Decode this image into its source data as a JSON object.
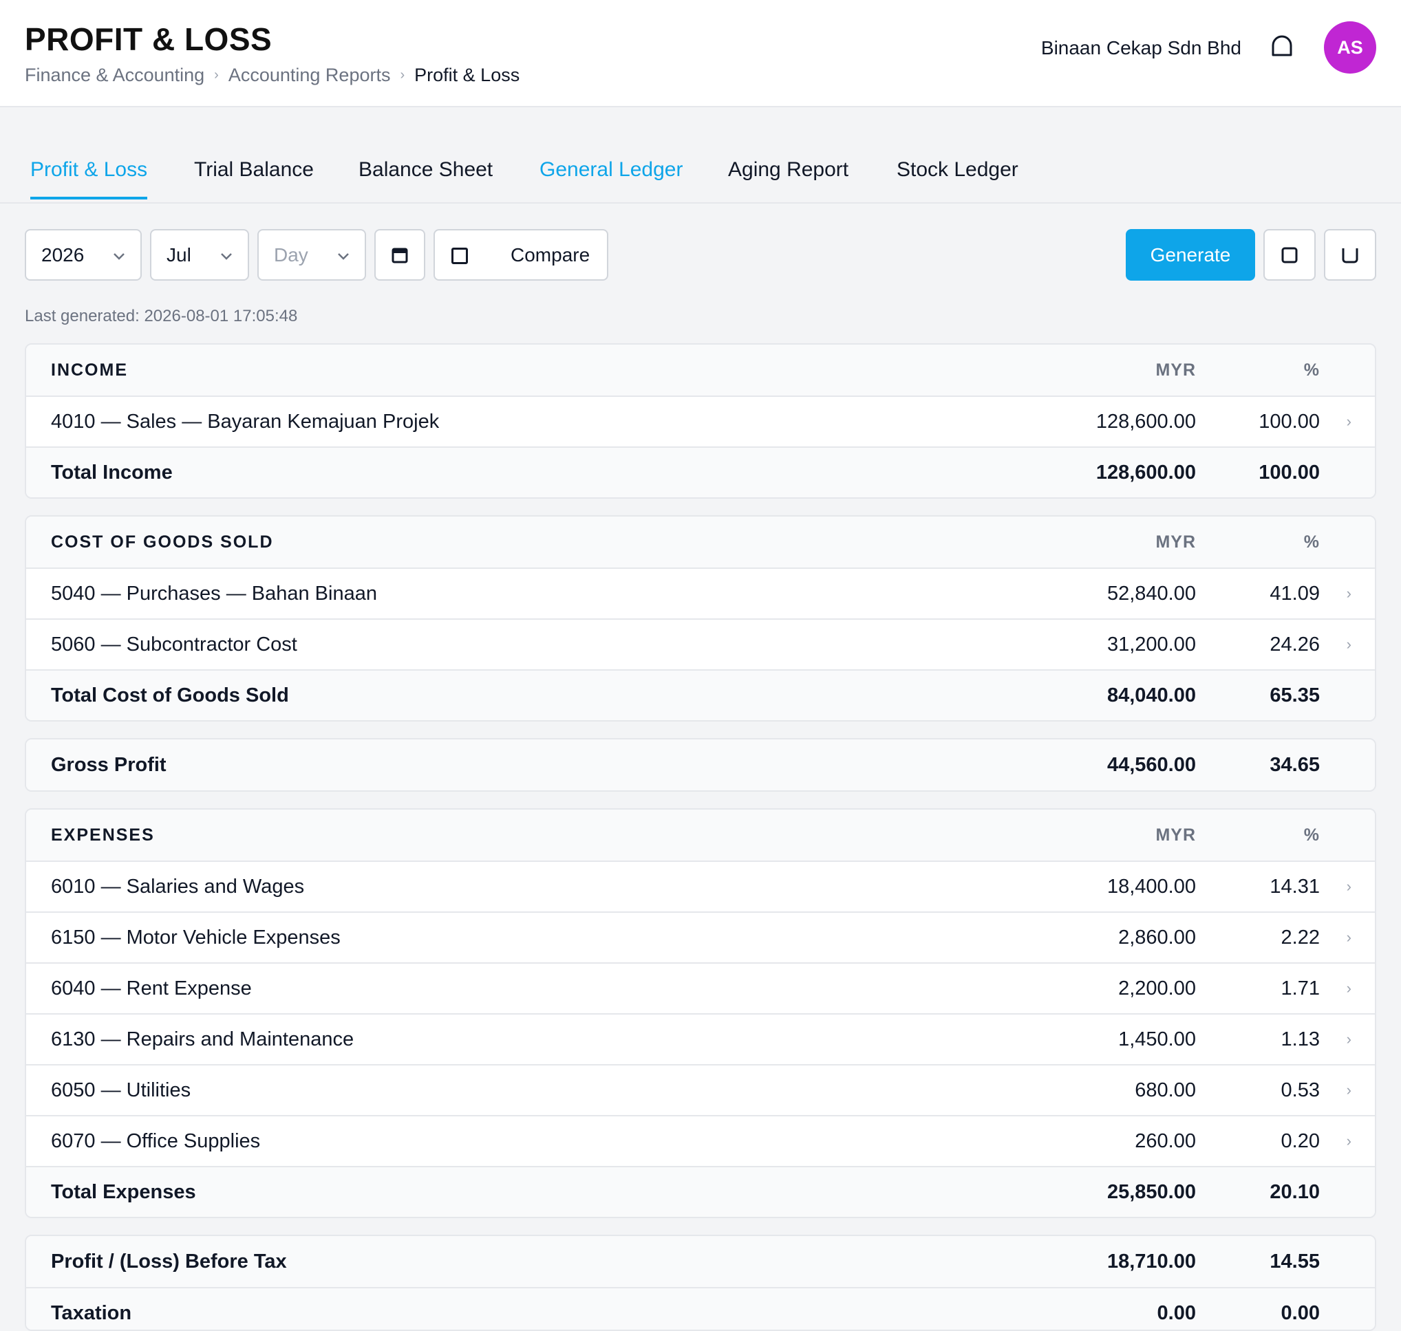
{
  "header": {
    "title": "PROFIT & LOSS",
    "breadcrumb": [
      "Finance & Accounting",
      "Accounting Reports",
      "Profit & Loss"
    ],
    "company": "Binaan Cekap Sdn Bhd",
    "avatar_initials": "AS",
    "avatar_color": "#c026d3"
  },
  "tabs": [
    {
      "label": "Profit & Loss",
      "state": "active"
    },
    {
      "label": "Trial Balance",
      "state": "normal"
    },
    {
      "label": "Balance Sheet",
      "state": "normal"
    },
    {
      "label": "General Ledger",
      "state": "link"
    },
    {
      "label": "Aging Report",
      "state": "normal"
    },
    {
      "label": "Stock Ledger",
      "state": "normal"
    }
  ],
  "filters": {
    "year": "2026",
    "month": "Jul",
    "day_placeholder": "Day",
    "compare_label": "Compare",
    "generate_label": "Generate",
    "accent_color": "#0ea5e9"
  },
  "last_generated": "Last generated: 2026-08-01 17:05:48",
  "columns": {
    "amount": "MYR",
    "percent": "%"
  },
  "income": {
    "heading": "INCOME",
    "rows": [
      {
        "label": "4010 — Sales — Bayaran Kemajuan Projek",
        "amount": "128,600.00",
        "percent": "100.00"
      }
    ],
    "total": {
      "label": "Total Income",
      "amount": "128,600.00",
      "percent": "100.00"
    }
  },
  "cogs": {
    "heading": "COST OF GOODS SOLD",
    "rows": [
      {
        "label": "5040 — Purchases — Bahan Binaan",
        "amount": "52,840.00",
        "percent": "41.09"
      },
      {
        "label": "5060 — Subcontractor Cost",
        "amount": "31,200.00",
        "percent": "24.26"
      }
    ],
    "total": {
      "label": "Total Cost of Goods Sold",
      "amount": "84,040.00",
      "percent": "65.35"
    }
  },
  "gross_profit": {
    "label": "Gross Profit",
    "amount": "44,560.00",
    "percent": "34.65"
  },
  "expenses": {
    "heading": "EXPENSES",
    "rows": [
      {
        "label": "6010 — Salaries and Wages",
        "amount": "18,400.00",
        "percent": "14.31"
      },
      {
        "label": "6150 — Motor Vehicle Expenses",
        "amount": "2,860.00",
        "percent": "2.22"
      },
      {
        "label": "6040 — Rent Expense",
        "amount": "2,200.00",
        "percent": "1.71"
      },
      {
        "label": "6130 — Repairs and Maintenance",
        "amount": "1,450.00",
        "percent": "1.13"
      },
      {
        "label": "6050 — Utilities",
        "amount": "680.00",
        "percent": "0.53"
      },
      {
        "label": "6070 — Office Supplies",
        "amount": "260.00",
        "percent": "0.20"
      }
    ],
    "total": {
      "label": "Total Expenses",
      "amount": "25,850.00",
      "percent": "20.10"
    }
  },
  "profit_before_tax": {
    "label": "Profit / (Loss) Before Tax",
    "amount": "18,710.00",
    "percent": "14.55"
  },
  "taxation": {
    "label": "Taxation",
    "amount": "0.00",
    "percent": "0.00"
  }
}
